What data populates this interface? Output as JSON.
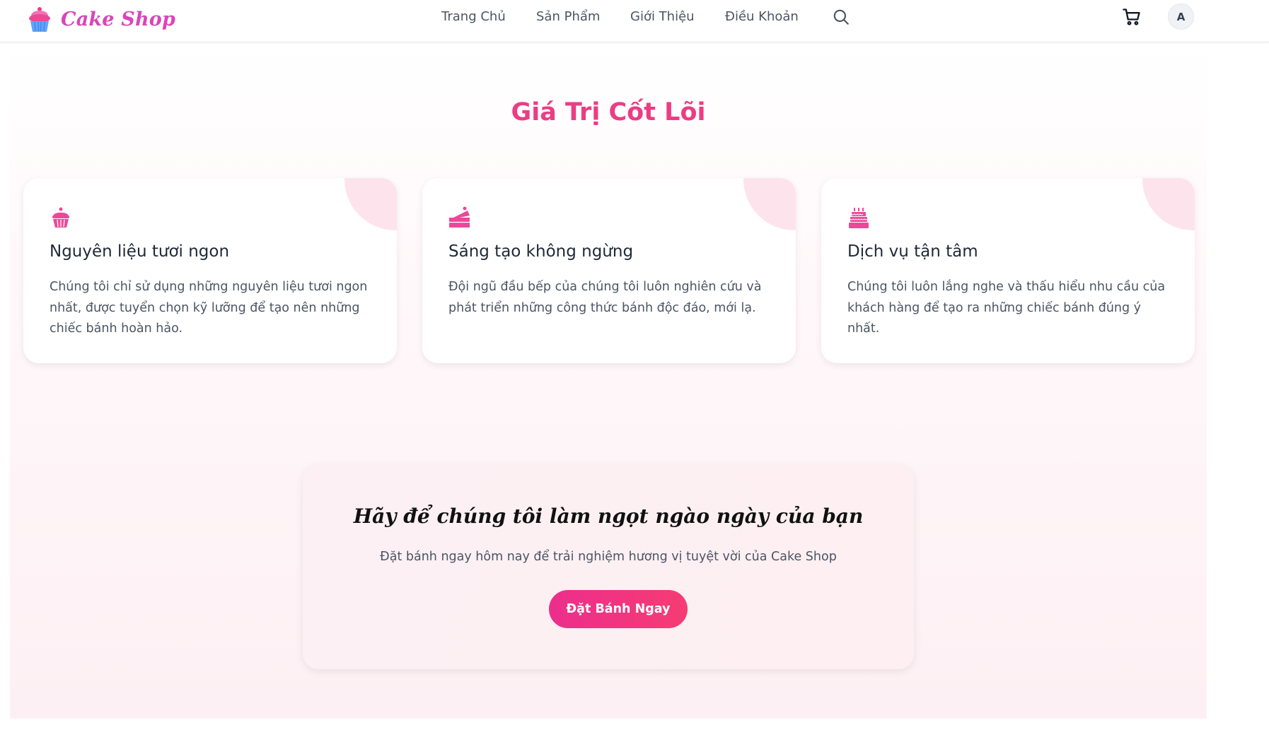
{
  "brand": {
    "name": "Cake Shop",
    "icon": "cupcake-icon",
    "color": "#d946b8"
  },
  "nav": {
    "links": [
      "Trang Chủ",
      "Sản Phẩm",
      "Giới Thiệu",
      "Điều Khoản"
    ],
    "search_icon": "search-icon",
    "cart_icon": "cart-icon",
    "avatar_initial": "A"
  },
  "core_values": {
    "title": "Giá Trị Cốt Lõi",
    "title_color": "#ec3d84",
    "cards": [
      {
        "icon": "cupcake-icon",
        "title": "Nguyên liệu tươi ngon",
        "description": "Chúng tôi chỉ sử dụng những nguyên liệu tươi ngon nhất, được tuyển chọn kỹ lưỡng để tạo nên những chiếc bánh hoàn hảo."
      },
      {
        "icon": "cake-slice-icon",
        "title": "Sáng tạo không ngừng",
        "description": "Đội ngũ đầu bếp của chúng tôi luôn nghiên cứu và phát triển những công thức bánh độc đáo, mới lạ."
      },
      {
        "icon": "birthday-cake-icon",
        "title": "Dịch vụ tận tâm",
        "description": "Chúng tôi luôn lắng nghe và thấu hiểu nhu cầu của khách hàng để tạo ra những chiếc bánh đúng ý nhất."
      }
    ]
  },
  "cta": {
    "title": "Hãy để chúng tôi làm ngọt ngào ngày của bạn",
    "subtitle": "Đặt bánh ngay hôm nay để trải nghiệm hương vị tuyệt vời của Cake Shop",
    "button_label": "Đặt Bánh Ngay",
    "button_color": "#ec2e8c"
  }
}
